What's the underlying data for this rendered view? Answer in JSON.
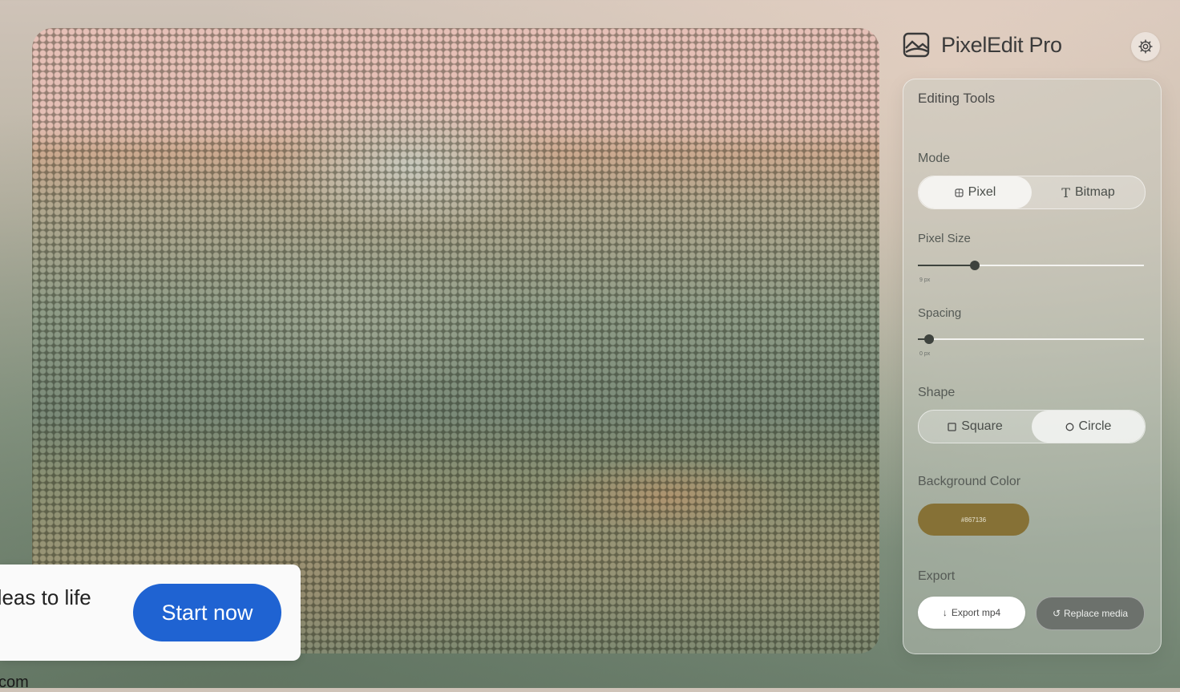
{
  "app": {
    "name": "PixelEdit Pro"
  },
  "panel": {
    "title": "Editing Tools",
    "mode": {
      "label": "Mode",
      "options": [
        "Pixel",
        "Bitmap"
      ],
      "selected": "Pixel"
    },
    "pixel_size": {
      "label": "Pixel Size",
      "value_text": "9 px",
      "fraction": 0.25
    },
    "spacing": {
      "label": "Spacing",
      "value_text": "0 px",
      "fraction": 0.05
    },
    "shape": {
      "label": "Shape",
      "options": [
        "Square",
        "Circle"
      ],
      "selected": "Circle"
    },
    "background_color": {
      "label": "Background Color",
      "value": "#867136"
    },
    "export": {
      "label": "Export",
      "export_label": "Export mp4",
      "replace_label": "Replace media"
    }
  },
  "icons": {
    "logo": "landscape-image-icon",
    "settings": "gear-icon",
    "pixel_mode": "pixel-grid-icon",
    "bitmap_mode": "text-t-icon",
    "square": "square-icon",
    "circle": "circle-icon",
    "export": "arrow-down-icon",
    "replace": "refresh-icon"
  },
  "promo": {
    "text": "deas to life",
    "button": "Start now",
    "url": "l.com"
  },
  "colors": {
    "accent_blue": "#1f63d2",
    "swatch": "#867136"
  }
}
